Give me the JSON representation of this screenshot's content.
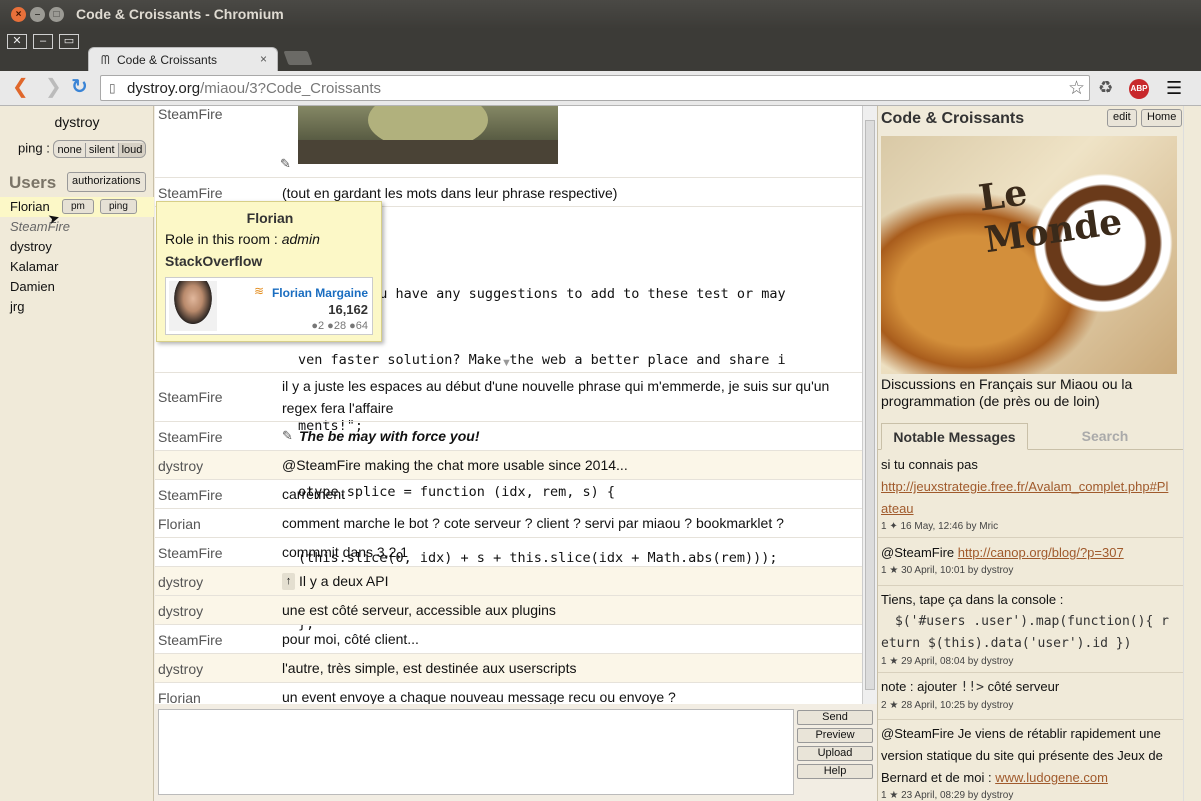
{
  "window": {
    "title": "Code & Croissants - Chromium"
  },
  "tab": {
    "title": "Code & Croissants"
  },
  "address": {
    "domain": "dystroy.org",
    "path": "/miaou/3?Code_Croissants"
  },
  "left": {
    "me": "dystroy",
    "ping_label": "ping :",
    "ping_options": [
      "none",
      "silent",
      "loud"
    ],
    "users_header": "Users",
    "authorizations": "authorizations",
    "pm": "pm",
    "ping": "ping",
    "users": [
      "Florian",
      "SteamFire",
      "dystroy",
      "Kalamar",
      "Damien",
      "jrg"
    ]
  },
  "tooltip": {
    "name": "Florian",
    "role_label": "Role in this room :",
    "role": "admin",
    "so_label": "StackOverflow",
    "so_name": "Florian Margaine",
    "rep": "16,162",
    "badges": "●2 ●28 ●64"
  },
  "messages": [
    {
      "author": "SteamFire",
      "text": ""
    },
    {
      "author": "SteamFire",
      "text": "(tout en gardant les mots dans leur phrase respective)"
    },
    {
      "author": "",
      "text": ""
    },
    {
      "author": "SteamFire",
      "text": "il y a juste les espaces au début d'une nouvelle phrase qui m'emmerde, je suis sur qu'un",
      "text2": "regex fera l'affaire"
    },
    {
      "author": "SteamFire",
      "text": "The be may with force you!"
    },
    {
      "author": "dystroy",
      "text": "@SteamFire making the chat more usable since 2014..."
    },
    {
      "author": "SteamFire",
      "text": "carrément"
    },
    {
      "author": "Florian",
      "text": "comment marche le bot ? cote serveur ? client ? servi par miaou ? bookmarklet ?"
    },
    {
      "author": "SteamFire",
      "text": "commmit dans 3,2,1"
    },
    {
      "author": "dystroy",
      "text": "Il y a deux API"
    },
    {
      "author": "dystroy",
      "text": "une est côté serveur, accessible aux plugins"
    },
    {
      "author": "SteamFire",
      "text": "pour moi, côté client..."
    },
    {
      "author": "dystroy",
      "text": "l'autre, très simple, est destinée aux userscripts"
    },
    {
      "author": "Florian",
      "text": "un event envoye a chaque nouveau message recu ou envoye ?"
    }
  ],
  "code_lines": [
    "g = \"Do you have any suggestions to add to these test or may",
    "ven faster solution? Make the web a better place and share i",
    "ments!\";",
    "otype.splice = function (idx, rem, s) {",
    "(this.slice(0, idx) + s + this.slice(idx + Math.abs(rem)));",
    "};"
  ],
  "actions": [
    "Send",
    "Preview",
    "Upload",
    "Help"
  ],
  "room": {
    "title": "Code & Croissants",
    "edit": "edit",
    "home": "Home",
    "image_text": "Le Monde",
    "description": "Discussions en Français sur Miaou ou la programmation (de près ou de loin)",
    "tabs": [
      "Notable Messages",
      "Search"
    ]
  },
  "notable": [
    {
      "text": "si tu connais pas",
      "link": "http://jeuxstrategie.free.fr/Avalam_complet.php#Pl",
      "link2": "ateau",
      "meta": "1 ✦ 16 May, 12:46 by Mric"
    },
    {
      "text": "@SteamFire",
      "link": "http://canop.org/blog/?p=307",
      "meta": "1 ★ 30 April, 10:01 by dystroy"
    },
    {
      "text": "Tiens, tape ça dans la console :",
      "code1": "$('#users .user').map(function(){ r",
      "code2": "eturn $(this).data('user').id })",
      "meta": "1 ★ 29 April, 08:04 by dystroy"
    },
    {
      "text": "note : ajouter",
      "code": "!!>",
      "text2": "côté serveur",
      "meta": "2 ★ 28 April, 10:25 by dystroy"
    },
    {
      "text": "@SteamFire Je viens de rétablir rapidement une",
      "text2": "version statique du site qui présente des Jeux de",
      "text3": "Bernard et de moi :",
      "link": "www.ludogene.com",
      "meta": "1 ★ 23 April, 08:29 by dystroy"
    }
  ]
}
